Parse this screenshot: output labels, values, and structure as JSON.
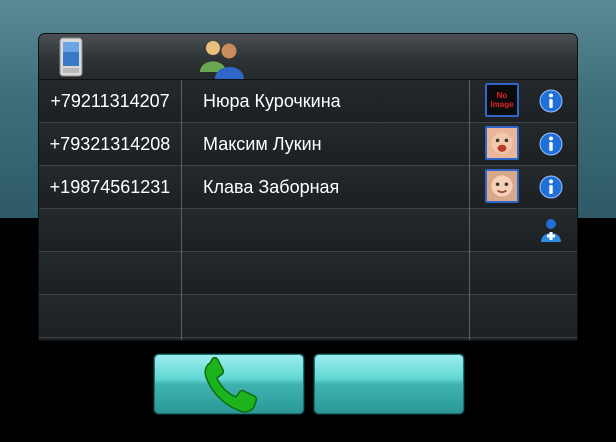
{
  "header": {
    "phone_icon": "mobile-phone-icon",
    "contacts_icon": "contacts-icon"
  },
  "contacts": [
    {
      "phone": "+79211314207",
      "name": "Нюра Курочкина",
      "avatar": "no-image",
      "avatar_text_1": "No",
      "avatar_text_2": "Image"
    },
    {
      "phone": "+79321314208",
      "name": "Максим Лукин",
      "avatar": "baby-photo"
    },
    {
      "phone": "+19874561231",
      "name": "Клава Заборная",
      "avatar": "baby-photo"
    }
  ],
  "actions": {
    "call_icon": "phone-handset-icon",
    "add_contact_icon": "add-contact-icon"
  },
  "colors": {
    "accent": "#5fd6d3",
    "call_green": "#1db31d",
    "info_blue": "#1f6fd8"
  }
}
